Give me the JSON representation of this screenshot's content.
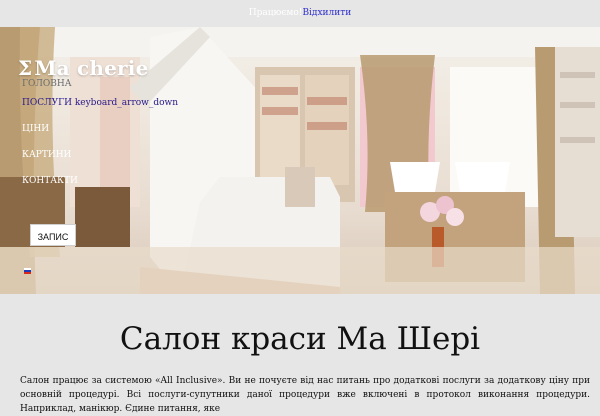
{
  "topbar": {
    "working": "Працюємо!",
    "open": "Відхилити"
  },
  "logo": {
    "text": "Ma cherie"
  },
  "nav": {
    "home": "ГОЛОВНА",
    "services": "ПОСЛУГИ",
    "services_icon": "keyboard_arrow_down",
    "items": [
      "ЦІНИ",
      "КАРТИНИ",
      "КОНТАКТИ"
    ]
  },
  "cta": {
    "label": "ЗАПИС"
  },
  "main": {
    "title": "Салон краси Ма Шері",
    "description": "Салон працює за системою «All Inclusive». Ви не почуєте від нас питань про додаткові послуги за додаткову ціну при основній процедурі. Всі послуги-супутники даної процедури вже включені в протокол виконання процедури. Наприклад, манікюр. Єдине питання, яке"
  },
  "colors": {
    "accent": "#2a1a8a",
    "link": "#2f2fcf"
  }
}
